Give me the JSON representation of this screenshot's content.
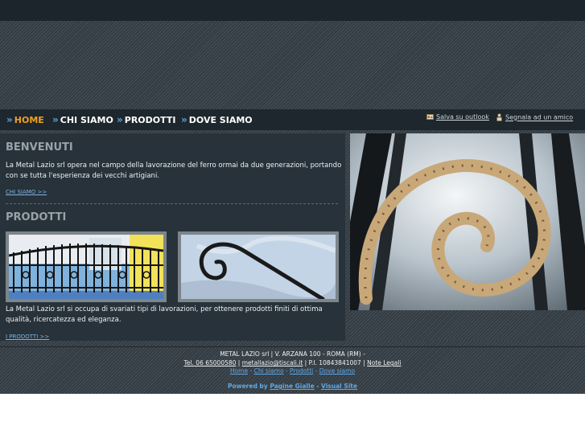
{
  "nav": {
    "items": [
      {
        "label": "HOME",
        "active": true
      },
      {
        "label": "CHI SIAMO"
      },
      {
        "label": "PRODOTTI"
      },
      {
        "label": "DOVE SIAMO"
      }
    ],
    "arrow": "»"
  },
  "tools": {
    "outlook": "Salva su outlook",
    "friend": "Segnala ad un amico"
  },
  "welcome": {
    "title": "BENVENUTI",
    "text": "La Metal Lazio srl opera nel campo della lavorazione del ferro ormai da due generazioni, portando con se tutta l'esperienza dei vecchi artigiani.",
    "more": "CHI SIAMO >>"
  },
  "products": {
    "title": "PRODOTTI",
    "text": "La Metal Lazio srl si occupa di svariati tipi di lavorazioni, per ottenere prodotti finiti di ottima qualità, ricercatezza ed eleganza.",
    "more": "I PRODOTTI >>"
  },
  "footer": {
    "line1": "METAL LAZIO srl | V. ARZANA 100 - ROMA (RM) -",
    "tel": "Tel. 06 65000580",
    "email": "metallazio@tiscali.it",
    "piva": "P.I. 10843841007",
    "legal": "Note Legali",
    "sep": "|",
    "links": [
      "Home",
      "Chi siamo",
      "Prodotti",
      "Dove siamo"
    ],
    "link_sep": "-",
    "powered": "Powered by",
    "pg": "Pagine Gialle",
    "vs": "Visual Site",
    "powered_sep": "-"
  },
  "colors": {
    "accent": "#f0a020",
    "link": "#5fa8e6",
    "panel": "#27323a",
    "bar": "#1e272d"
  }
}
